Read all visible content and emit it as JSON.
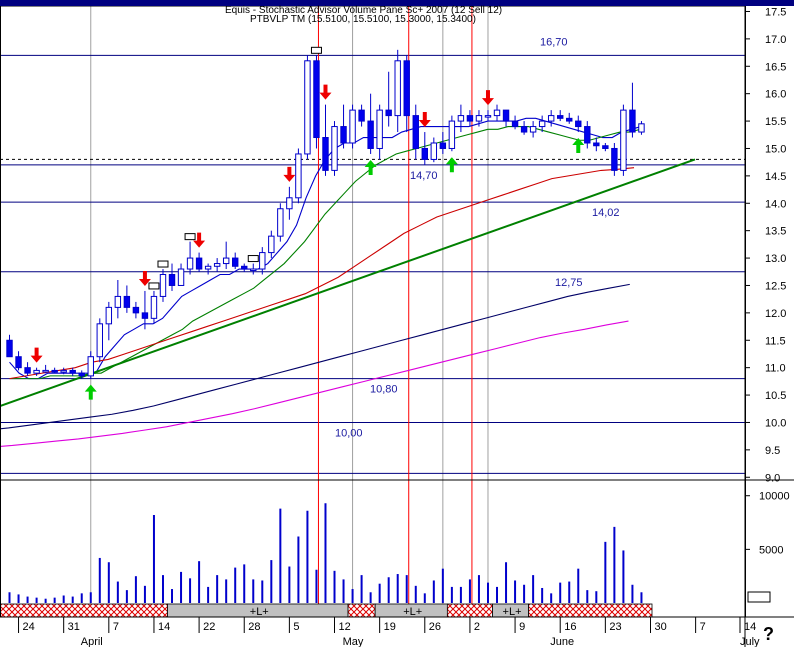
{
  "header": {
    "line1": "Equis - Stochastic Advisor Volume Pane Sc+ 2007 (12 Sell 12)",
    "line2": "PTBVLP TM (15.5100, 15.5100, 15.3000, 15.3400)"
  },
  "help_mark": "?",
  "colors": {
    "candle_up": "#ffffff",
    "candle_down": "#0000ee",
    "volume": "#0000cc",
    "ma_short": "#0000cc",
    "ma_mid": "#008000",
    "ma_long_red": "#cc0000",
    "ma_long_navy": "#000066",
    "ma_long_magenta": "#dd00dd",
    "trend_line": "#008000",
    "level_line": "#000080",
    "vline_red": "#ff0000",
    "vline_grey": "#a0a0a0",
    "arrow_sell": "#ee0000",
    "arrow_buy": "#00cc00"
  },
  "chart_data": {
    "type": "candlestick",
    "y_axis": {
      "ticks": [
        "17.5",
        "17.0",
        "16.5",
        "16.0",
        "15.5",
        "15.0",
        "14.5",
        "14.0",
        "13.5",
        "13.0",
        "12.5",
        "12.0",
        "11.5",
        "11.0",
        "10.5",
        "10.0",
        "9.5",
        "9.0"
      ],
      "range": [
        8.95,
        17.6
      ]
    },
    "volume_axis": {
      "ticks": [
        "10000",
        "5000"
      ],
      "range": [
        0,
        11000
      ]
    },
    "x_axis": {
      "day_ticks": [
        "24",
        "31",
        "7",
        "14",
        "22",
        "28",
        "5",
        "12",
        "19",
        "26",
        "2",
        "9",
        "16",
        "23",
        "30",
        "7",
        "14"
      ],
      "month_labels": [
        "April",
        "May",
        "June",
        "July"
      ]
    },
    "horizontal_levels": [
      {
        "value": 16.7,
        "label": "16,70"
      },
      {
        "value": 14.7,
        "label": "14,70"
      },
      {
        "value": 14.02,
        "label": "14,02"
      },
      {
        "value": 12.75,
        "label": "12,75"
      },
      {
        "value": 10.8,
        "label": "10,80"
      },
      {
        "value": 10.0,
        "label": "10,00"
      },
      {
        "value": 9.07,
        "label": ""
      }
    ],
    "signal_bar": [
      {
        "from": "17",
        "to": "17",
        "kind": "hatch",
        "label": ""
      },
      {
        "from": "18",
        "to": "37",
        "kind": "grey",
        "label": "+L+"
      },
      {
        "from": "38",
        "to": "40",
        "kind": "hatch",
        "label": ""
      },
      {
        "from": "41",
        "to": "48",
        "kind": "grey",
        "label": "+L+"
      },
      {
        "from": "49",
        "to": "53",
        "kind": "hatch",
        "label": ""
      },
      {
        "from": "54",
        "to": "57",
        "kind": "grey",
        "label": "+L+"
      },
      {
        "from": "58",
        "to": "70",
        "kind": "hatch",
        "label": ""
      }
    ],
    "candles": [
      {
        "o": 11.5,
        "h": 11.6,
        "l": 11.2,
        "c": 11.2
      },
      {
        "o": 11.2,
        "h": 11.3,
        "l": 10.95,
        "c": 11.0
      },
      {
        "o": 11.0,
        "h": 11.1,
        "l": 10.85,
        "c": 10.9
      },
      {
        "o": 10.9,
        "h": 11.0,
        "l": 10.85,
        "c": 10.95
      },
      {
        "o": 10.95,
        "h": 11.05,
        "l": 10.9,
        "c": 10.95
      },
      {
        "o": 10.95,
        "h": 11.0,
        "l": 10.9,
        "c": 10.92
      },
      {
        "o": 10.92,
        "h": 11.0,
        "l": 10.88,
        "c": 10.95
      },
      {
        "o": 10.95,
        "h": 11.0,
        "l": 10.85,
        "c": 10.9
      },
      {
        "o": 10.9,
        "h": 10.95,
        "l": 10.8,
        "c": 10.85
      },
      {
        "o": 10.85,
        "h": 11.3,
        "l": 10.8,
        "c": 11.2
      },
      {
        "o": 11.2,
        "h": 11.9,
        "l": 11.1,
        "c": 11.8
      },
      {
        "o": 11.8,
        "h": 12.2,
        "l": 11.5,
        "c": 12.1
      },
      {
        "o": 12.1,
        "h": 12.6,
        "l": 11.9,
        "c": 12.3
      },
      {
        "o": 12.3,
        "h": 12.5,
        "l": 12.0,
        "c": 12.1
      },
      {
        "o": 12.1,
        "h": 12.2,
        "l": 11.9,
        "c": 12.0
      },
      {
        "o": 12.0,
        "h": 12.4,
        "l": 11.7,
        "c": 11.9
      },
      {
        "o": 11.9,
        "h": 12.4,
        "l": 11.8,
        "c": 12.3
      },
      {
        "o": 12.3,
        "h": 12.8,
        "l": 12.2,
        "c": 12.7
      },
      {
        "o": 12.7,
        "h": 12.9,
        "l": 12.4,
        "c": 12.5
      },
      {
        "o": 12.5,
        "h": 12.9,
        "l": 12.5,
        "c": 12.8
      },
      {
        "o": 12.8,
        "h": 13.3,
        "l": 12.7,
        "c": 13.0
      },
      {
        "o": 13.0,
        "h": 13.1,
        "l": 12.75,
        "c": 12.8
      },
      {
        "o": 12.8,
        "h": 12.9,
        "l": 12.7,
        "c": 12.85
      },
      {
        "o": 12.85,
        "h": 13.0,
        "l": 12.75,
        "c": 12.9
      },
      {
        "o": 12.9,
        "h": 13.3,
        "l": 12.8,
        "c": 13.0
      },
      {
        "o": 13.0,
        "h": 13.1,
        "l": 12.8,
        "c": 12.85
      },
      {
        "o": 12.85,
        "h": 12.9,
        "l": 12.75,
        "c": 12.8
      },
      {
        "o": 12.8,
        "h": 12.9,
        "l": 12.7,
        "c": 12.8
      },
      {
        "o": 12.8,
        "h": 13.2,
        "l": 12.7,
        "c": 13.1
      },
      {
        "o": 13.1,
        "h": 13.5,
        "l": 13.0,
        "c": 13.4
      },
      {
        "o": 13.4,
        "h": 14.0,
        "l": 13.3,
        "c": 13.9
      },
      {
        "o": 13.9,
        "h": 14.3,
        "l": 13.7,
        "c": 14.1
      },
      {
        "o": 14.1,
        "h": 15.0,
        "l": 14.0,
        "c": 14.9
      },
      {
        "o": 14.9,
        "h": 16.7,
        "l": 14.8,
        "c": 16.6
      },
      {
        "o": 16.6,
        "h": 16.7,
        "l": 15.0,
        "c": 15.2
      },
      {
        "o": 15.2,
        "h": 15.8,
        "l": 14.5,
        "c": 14.6
      },
      {
        "o": 14.6,
        "h": 15.5,
        "l": 14.5,
        "c": 15.4
      },
      {
        "o": 15.4,
        "h": 15.8,
        "l": 15.0,
        "c": 15.1
      },
      {
        "o": 15.1,
        "h": 15.8,
        "l": 15.0,
        "c": 15.7
      },
      {
        "o": 15.7,
        "h": 15.8,
        "l": 15.4,
        "c": 15.5
      },
      {
        "o": 15.5,
        "h": 16.0,
        "l": 14.9,
        "c": 15.0
      },
      {
        "o": 15.0,
        "h": 15.8,
        "l": 14.8,
        "c": 15.7
      },
      {
        "o": 15.7,
        "h": 16.4,
        "l": 15.4,
        "c": 15.6
      },
      {
        "o": 15.6,
        "h": 16.8,
        "l": 15.3,
        "c": 16.6
      },
      {
        "o": 16.6,
        "h": 16.7,
        "l": 15.3,
        "c": 15.6
      },
      {
        "o": 15.6,
        "h": 15.8,
        "l": 14.8,
        "c": 15.0
      },
      {
        "o": 15.0,
        "h": 15.3,
        "l": 14.7,
        "c": 14.8
      },
      {
        "o": 14.8,
        "h": 15.2,
        "l": 14.75,
        "c": 15.1
      },
      {
        "o": 15.1,
        "h": 15.3,
        "l": 14.9,
        "c": 15.0
      },
      {
        "o": 15.0,
        "h": 15.6,
        "l": 14.95,
        "c": 15.5
      },
      {
        "o": 15.5,
        "h": 15.8,
        "l": 15.3,
        "c": 15.6
      },
      {
        "o": 15.6,
        "h": 15.7,
        "l": 15.4,
        "c": 15.5
      },
      {
        "o": 15.5,
        "h": 15.7,
        "l": 15.4,
        "c": 15.6
      },
      {
        "o": 15.6,
        "h": 15.7,
        "l": 15.5,
        "c": 15.6
      },
      {
        "o": 15.6,
        "h": 15.8,
        "l": 15.5,
        "c": 15.7
      },
      {
        "o": 15.7,
        "h": 15.7,
        "l": 15.4,
        "c": 15.5
      },
      {
        "o": 15.5,
        "h": 15.6,
        "l": 15.35,
        "c": 15.4
      },
      {
        "o": 15.4,
        "h": 15.5,
        "l": 15.25,
        "c": 15.3
      },
      {
        "o": 15.3,
        "h": 15.5,
        "l": 15.2,
        "c": 15.4
      },
      {
        "o": 15.4,
        "h": 15.6,
        "l": 15.3,
        "c": 15.5
      },
      {
        "o": 15.5,
        "h": 15.7,
        "l": 15.4,
        "c": 15.6
      },
      {
        "o": 15.6,
        "h": 15.7,
        "l": 15.5,
        "c": 15.55
      },
      {
        "o": 15.55,
        "h": 15.65,
        "l": 15.45,
        "c": 15.5
      },
      {
        "o": 15.5,
        "h": 15.6,
        "l": 15.3,
        "c": 15.4
      },
      {
        "o": 15.4,
        "h": 15.5,
        "l": 15.0,
        "c": 15.1
      },
      {
        "o": 15.1,
        "h": 15.2,
        "l": 14.95,
        "c": 15.05
      },
      {
        "o": 15.05,
        "h": 15.1,
        "l": 14.95,
        "c": 15.0
      },
      {
        "o": 15.0,
        "h": 15.1,
        "l": 14.5,
        "c": 14.6
      },
      {
        "o": 14.6,
        "h": 15.8,
        "l": 14.5,
        "c": 15.7
      },
      {
        "o": 15.7,
        "h": 16.2,
        "l": 15.2,
        "c": 15.3
      },
      {
        "o": 15.3,
        "h": 15.5,
        "l": 15.25,
        "c": 15.45
      }
    ],
    "volume": [
      1000,
      800,
      600,
      500,
      400,
      500,
      700,
      600,
      900,
      1000,
      4200,
      3800,
      2000,
      1200,
      2500,
      1600,
      8200,
      2600,
      1300,
      2900,
      2300,
      3900,
      1500,
      2600,
      2200,
      3300,
      3600,
      2200,
      2100,
      4000,
      8800,
      3400,
      6200,
      8600,
      3100,
      9300,
      3000,
      2200,
      1300,
      2600,
      1000,
      1800,
      2400,
      2700,
      2600,
      1600,
      900,
      2100,
      3200,
      1500,
      1500,
      2200,
      2600,
      1900,
      1500,
      3800,
      2100,
      1700,
      2600,
      1400,
      900,
      1900,
      2000,
      3200,
      1200,
      1100,
      5700,
      7100,
      4900,
      1700,
      1000
    ],
    "moving_averages": [
      {
        "id": "ma_short",
        "values": [
          11.1,
          10.9,
          10.8,
          10.8,
          10.9,
          10.9,
          10.9,
          10.9,
          10.9,
          10.9,
          11.2,
          11.4,
          11.6,
          11.7,
          11.8,
          11.8,
          11.9,
          12.1,
          12.3,
          12.4,
          12.5,
          12.6,
          12.7,
          12.7,
          12.8,
          12.8,
          12.8,
          12.9,
          13.1,
          13.3,
          13.6,
          14.1,
          14.5,
          14.8,
          15.0,
          15.1,
          15.1,
          15.2,
          15.2,
          15.2,
          15.2,
          15.3,
          15.35,
          15.4,
          15.4,
          15.4,
          15.4,
          15.4,
          15.4,
          15.45,
          15.5,
          15.5,
          15.5,
          15.5,
          15.55,
          15.55,
          15.5,
          15.45,
          15.4,
          15.35,
          15.3,
          15.25,
          15.2,
          15.2,
          15.3,
          15.35,
          15.4
        ]
      },
      {
        "id": "ma_mid",
        "values": [
          10.8,
          10.8,
          10.8,
          10.8,
          10.85,
          10.85,
          10.85,
          10.85,
          10.9,
          10.9,
          11.0,
          11.1,
          11.2,
          11.3,
          11.4,
          11.5,
          11.6,
          11.7,
          11.85,
          11.95,
          12.05,
          12.15,
          12.25,
          12.35,
          12.45,
          12.6,
          12.75,
          12.9,
          13.1,
          13.3,
          13.55,
          13.8,
          14.0,
          14.2,
          14.4,
          14.55,
          14.7,
          14.8,
          14.9,
          14.95,
          15.0,
          15.05,
          15.1,
          15.15,
          15.2,
          15.25,
          15.3,
          15.35,
          15.35,
          15.4,
          15.4,
          15.4,
          15.35,
          15.3,
          15.25,
          15.2,
          15.15,
          15.15,
          15.2,
          15.25,
          15.3,
          15.3,
          15.35
        ]
      },
      {
        "id": "ma_long_red",
        "values": [
          10.8,
          10.85,
          10.9,
          10.95,
          11.0,
          11.1,
          11.15,
          11.25,
          11.35,
          11.45,
          11.55,
          11.65,
          11.75,
          11.85,
          11.95,
          12.05,
          12.15,
          12.25,
          12.35,
          12.5,
          12.65,
          12.85,
          13.05,
          13.25,
          13.45,
          13.6,
          13.75,
          13.85,
          13.95,
          14.05,
          14.15,
          14.25,
          14.35,
          14.45,
          14.5,
          14.55,
          14.6,
          14.62,
          14.65
        ]
      },
      {
        "id": "ma_long_navy",
        "values": [
          9.8,
          9.83,
          9.86,
          9.9,
          9.95,
          10.0,
          10.05,
          10.1,
          10.15,
          10.22,
          10.3,
          10.4,
          10.5,
          10.6,
          10.7,
          10.8,
          10.9,
          11.0,
          11.1,
          11.2,
          11.3,
          11.4,
          11.5,
          11.6,
          11.7,
          11.8,
          11.9,
          12.0,
          12.1,
          12.2,
          12.3,
          12.38,
          12.45,
          12.52
        ]
      },
      {
        "id": "ma_long_magenta",
        "values": [
          9.5,
          9.52,
          9.55,
          9.58,
          9.62,
          9.66,
          9.7,
          9.75,
          9.8,
          9.86,
          9.92,
          10.0,
          10.08,
          10.16,
          10.25,
          10.35,
          10.45,
          10.55,
          10.65,
          10.75,
          10.85,
          10.95,
          11.05,
          11.15,
          11.25,
          11.35,
          11.45,
          11.55,
          11.63,
          11.7,
          11.78,
          11.85
        ]
      }
    ],
    "trend_line": {
      "start": 10.3,
      "end": 14.8
    },
    "sell_arrows": [
      3,
      15,
      21,
      31,
      35,
      46,
      53
    ],
    "buy_arrows": [
      9,
      40,
      49,
      63
    ],
    "event_markers": [
      16,
      17,
      20,
      27,
      34
    ]
  }
}
